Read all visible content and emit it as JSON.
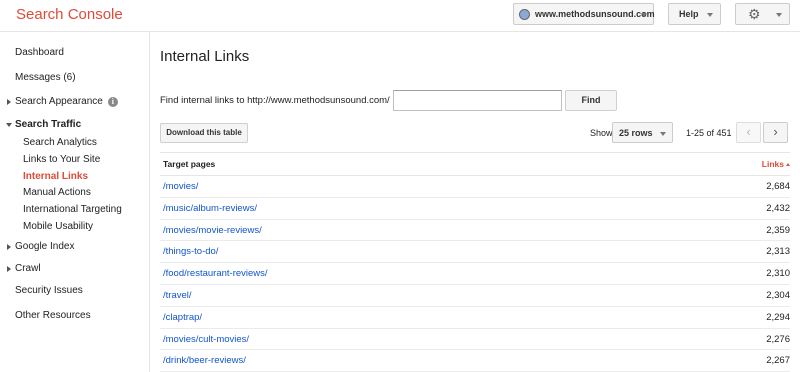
{
  "app": {
    "brand": "Search Console"
  },
  "header": {
    "site": "www.methodsunsound.com",
    "help_label": "Help"
  },
  "sidebar": {
    "items": [
      {
        "label": "Dashboard"
      },
      {
        "label": "Messages (6)"
      },
      {
        "label": "Search Appearance"
      },
      {
        "label": "Search Traffic"
      },
      {
        "label": "Search Analytics"
      },
      {
        "label": "Links to Your Site"
      },
      {
        "label": "Internal Links"
      },
      {
        "label": "Manual Actions"
      },
      {
        "label": "International Targeting"
      },
      {
        "label": "Mobile Usability"
      },
      {
        "label": "Google Index"
      },
      {
        "label": "Crawl"
      },
      {
        "label": "Security Issues"
      },
      {
        "label": "Other Resources"
      }
    ],
    "active": "Internal Links"
  },
  "main": {
    "title": "Internal Links",
    "find_label": "Find internal links to http://www.methodsunsound.com/",
    "find_value": "",
    "find_button": "Find",
    "download_button": "Download this table",
    "show_label": "Show",
    "rows_select": "25 rows",
    "range": "1-25 of 451"
  },
  "table": {
    "col_target": "Target pages",
    "col_links": "Links",
    "rows": [
      {
        "page": "/movies/",
        "links": "2,684"
      },
      {
        "page": "/music/album-reviews/",
        "links": "2,432"
      },
      {
        "page": "/movies/movie-reviews/",
        "links": "2,359"
      },
      {
        "page": "/things-to-do/",
        "links": "2,313"
      },
      {
        "page": "/food/restaurant-reviews/",
        "links": "2,310"
      },
      {
        "page": "/travel/",
        "links": "2,304"
      },
      {
        "page": "/claptrap/",
        "links": "2,294"
      },
      {
        "page": "/movies/cult-movies/",
        "links": "2,276"
      },
      {
        "page": "/drink/beer-reviews/",
        "links": "2,267"
      }
    ]
  },
  "colors": {
    "brand": "#dd4b39",
    "link": "#1155cc"
  },
  "icons": {
    "site": "globe-icon",
    "settings": "gear-icon",
    "info": "info-icon"
  }
}
